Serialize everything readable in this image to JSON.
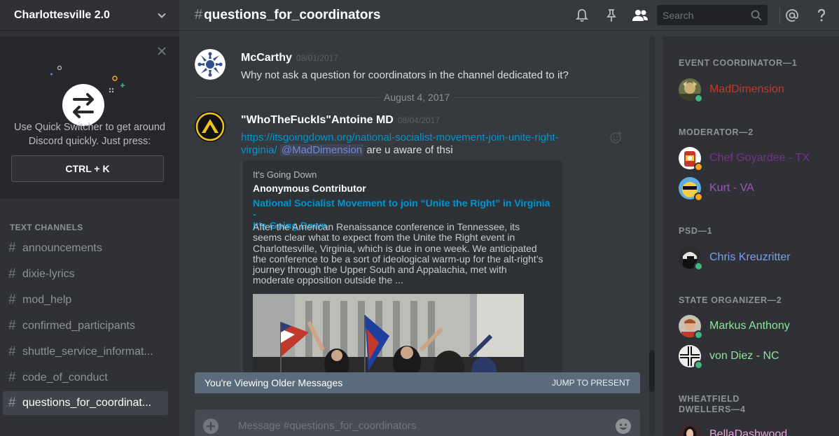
{
  "server": {
    "name": "Charlottesville 2.0"
  },
  "quick_switcher": {
    "text_line1": "Use Quick Switcher to get around",
    "text_line2": "Discord quickly. Just press:",
    "shortcut": "CTRL + K"
  },
  "channels": {
    "label": "TEXT CHANNELS",
    "items": [
      {
        "name": "announcements"
      },
      {
        "name": "dixie-lyrics"
      },
      {
        "name": "mod_help"
      },
      {
        "name": "confirmed_participants"
      },
      {
        "name": "shuttle_service_informat..."
      },
      {
        "name": "code_of_conduct"
      },
      {
        "name": "questions_for_coordinat...",
        "active": true
      }
    ]
  },
  "header": {
    "hash": "#",
    "channel": "questions_for_coordinators",
    "search_placeholder": "Search"
  },
  "messages": [
    {
      "author": "McCarthy",
      "timestamp": "08/01/2017",
      "text": "Why not ask a question for coordinators in the channel dedicated to it?"
    },
    {
      "author": "\"WhoTheFuckIs\"Antoine MD",
      "timestamp": "08/04/2017",
      "link_line1": "https://itsgoingdown.org/national-socialist-movement-join-unite-right-",
      "link_line2": "virginia/",
      "mention": "@MadDimension",
      "text_after": "are u aware of thsi",
      "embed": {
        "provider": "It's Going Down",
        "author": "Anonymous Contributor",
        "title_line1": "National Socialist Movement to join “Unite the Right” in Virginia -",
        "title_line2": "It's Going Down",
        "description_lines": [
          "After the American Renaissance conference in Tennessee, its",
          "seems clear what to expect from the Unite the Right event in",
          "Charlottesville, Virginia, which is due in one week. We anticipated",
          "the conference to be a sort of ideological warm-up for the alt-right’s",
          "journey through the Upper South and Appalachia, met with",
          "moderate opposition outside the ..."
        ]
      }
    }
  ],
  "date_divider": "August 4, 2017",
  "older_bar": {
    "text": "You're Viewing Older Messages",
    "jump": "JUMP TO PRESENT"
  },
  "composer": {
    "placeholder": "Message #questions_for_coordinators"
  },
  "members": {
    "roles": [
      {
        "label": "EVENT COORDINATOR—1",
        "members": [
          {
            "name": "MadDimension",
            "color": "#c0392b",
            "status": "online"
          }
        ]
      },
      {
        "label": "MODERATOR—2",
        "members": [
          {
            "name": "Chef Goyardee - TX",
            "color": "#71368a",
            "status": "idle"
          },
          {
            "name": "Kurt - VA",
            "color": "#9b59b6",
            "status": "idle"
          }
        ]
      },
      {
        "label": "PSD—1",
        "members": [
          {
            "name": "Chris Kreuzritter",
            "color": "#7f9fea",
            "status": "online"
          }
        ]
      },
      {
        "label": "STATE ORGANIZER—2",
        "members": [
          {
            "name": "Markus Anthony",
            "color": "#8ee49a",
            "status": "online"
          },
          {
            "name": "von Diez - NC",
            "color": "#8ee49a",
            "status": "online"
          }
        ]
      },
      {
        "label": "WHEATFIELD DWELLERS—4",
        "members": [
          {
            "name": "BellaDashwood",
            "color": "#e8a3d8",
            "status": "online"
          }
        ]
      }
    ]
  },
  "colors": {
    "online": "#43b581",
    "idle": "#faa61a",
    "link": "#0096cf",
    "mention": "#7289da"
  }
}
